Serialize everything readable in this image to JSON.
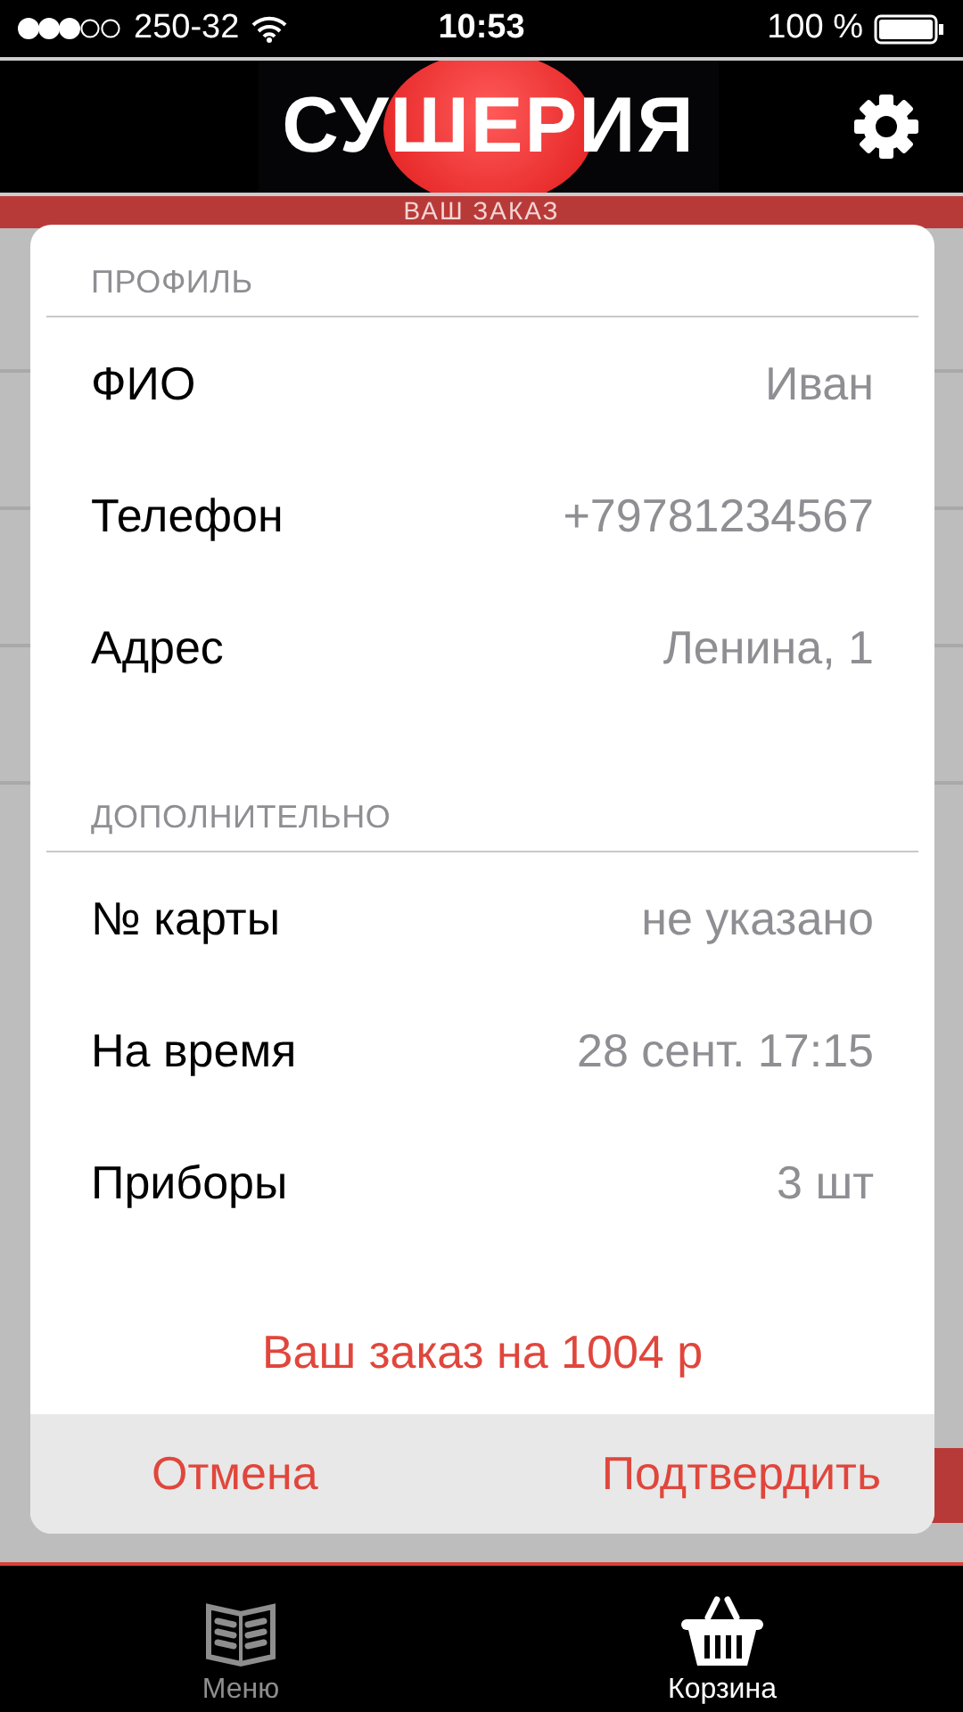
{
  "status_bar": {
    "carrier": "250-32",
    "time": "10:53",
    "battery": "100 %"
  },
  "header": {
    "logo": "СУШЕРИЯ"
  },
  "page_title": "ВАШ ЗАКАЗ",
  "dialog": {
    "sections": [
      {
        "title": "ПРОФИЛЬ",
        "rows": [
          {
            "label": "ФИО",
            "value": "Иван"
          },
          {
            "label": "Телефон",
            "value": "+79781234567"
          },
          {
            "label": "Адрес",
            "value": "Ленина, 1"
          }
        ]
      },
      {
        "title": "ДОПОЛНИТЕЛЬНО",
        "rows": [
          {
            "label": "№ карты",
            "value": "не указано"
          },
          {
            "label": "На время",
            "value": "28 сент. 17:15"
          },
          {
            "label": "Приборы",
            "value": "3 шт"
          }
        ]
      }
    ],
    "total": "Ваш заказ на 1004 р",
    "buttons": [
      "Отмена",
      "Подтвердить"
    ]
  },
  "tab_bar": [
    {
      "kind": "menu",
      "label": "Меню",
      "selected": false
    },
    {
      "kind": "basket",
      "label": "Корзина",
      "selected": true
    }
  ]
}
